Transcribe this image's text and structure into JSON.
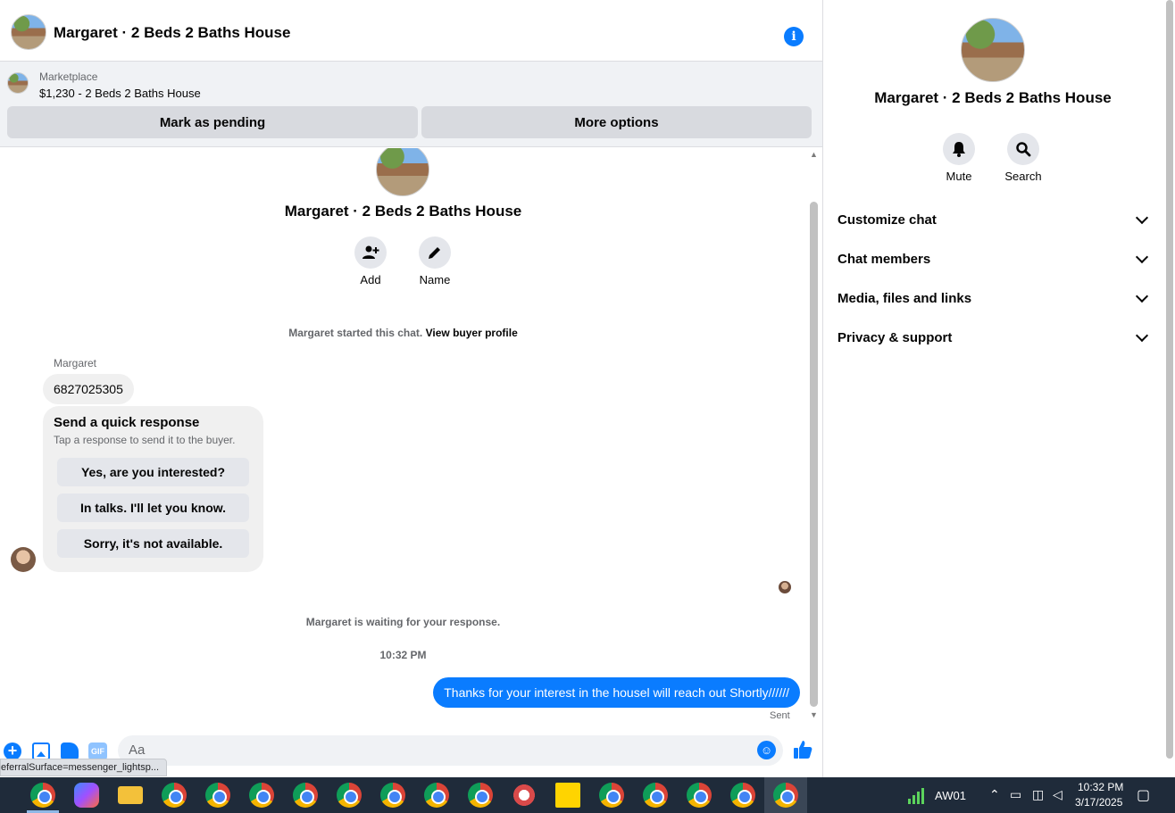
{
  "header": {
    "title": "Margaret · 2 Beds 2 Baths House",
    "info_icon": "i"
  },
  "marketplace": {
    "label": "Marketplace",
    "listing": "$1,230 - 2 Beds 2 Baths House",
    "mark_pending": "Mark as pending",
    "more_options": "More options"
  },
  "thread": {
    "name": "Margaret · 2 Beds 2 Baths House",
    "add_label": "Add",
    "name_label": "Name",
    "started_text": "Margaret started this chat.",
    "view_profile": "View buyer profile",
    "sender": "Margaret",
    "phone_message": "6827025305",
    "quick_title": "Send a quick response",
    "quick_sub": "Tap a response to send it to the buyer.",
    "quick_options": [
      "Yes, are you interested?",
      "In talks. I'll let you know.",
      "Sorry, it's not available."
    ],
    "waiting_text": "Margaret is waiting for your response.",
    "time": "10:32 PM",
    "outgoing": "Thanks for your interest in the housel will reach out Shortly//////",
    "sent": "Sent"
  },
  "composer": {
    "placeholder": "Aa",
    "gif": "GIF"
  },
  "status_url": "eferralSurface=messenger_lightsp...",
  "right_panel": {
    "name": "Margaret · 2 Beds 2 Baths House",
    "mute": "Mute",
    "search": "Search",
    "sections": [
      "Customize chat",
      "Chat members",
      "Media, files and links",
      "Privacy & support"
    ]
  },
  "taskbar": {
    "network_label": "AW01",
    "time": "10:32 PM",
    "date": "3/17/2025"
  },
  "colors": {
    "accent": "#0a7cff",
    "taskbar": "#1f2b3a"
  }
}
